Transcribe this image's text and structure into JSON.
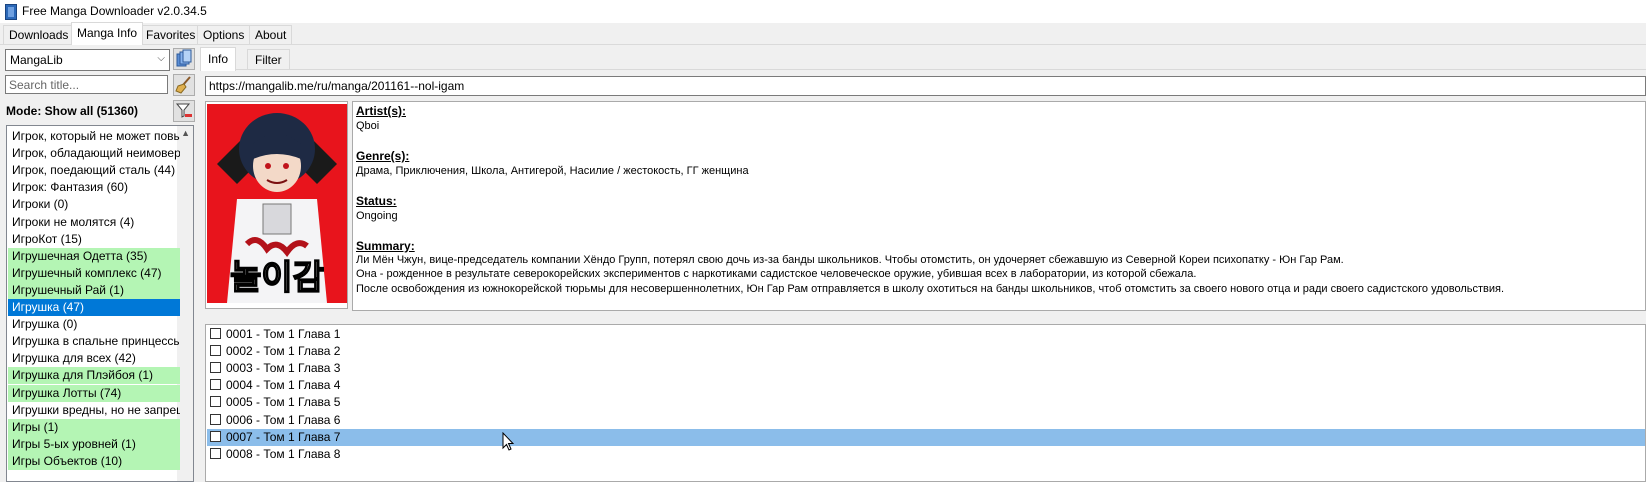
{
  "window": {
    "title": "Free Manga Downloader v2.0.34.5"
  },
  "main_tabs": [
    {
      "label": "Downloads"
    },
    {
      "label": "Manga Info"
    },
    {
      "label": "Favorites"
    },
    {
      "label": "Options"
    },
    {
      "label": "About"
    }
  ],
  "left_panel": {
    "source_selected": "MangaLib",
    "search_placeholder": "Search title...",
    "mode_label": "Mode: Show all (51360)",
    "titles": [
      {
        "label": "Игрок, который не может повы",
        "style": "normal"
      },
      {
        "label": "Игрок, обладающий неимоверн",
        "style": "normal"
      },
      {
        "label": "Игрок, поедающий сталь (44)",
        "style": "normal"
      },
      {
        "label": "Игрок: Фантазия (60)",
        "style": "normal"
      },
      {
        "label": "Игроки (0)",
        "style": "normal"
      },
      {
        "label": "Игроки не молятся (4)",
        "style": "normal"
      },
      {
        "label": "ИгроКот (15)",
        "style": "normal"
      },
      {
        "label": "Игрушечная Одетта (35)",
        "style": "green"
      },
      {
        "label": "Игрушечный комплекс (47)",
        "style": "green"
      },
      {
        "label": "Игрушечный Рай (1)",
        "style": "green"
      },
      {
        "label": "Игрушка (47)",
        "style": "selected"
      },
      {
        "label": "Игрушка (0)",
        "style": "normal"
      },
      {
        "label": "Игрушка в спальне принцессы",
        "style": "normal"
      },
      {
        "label": "Игрушка для всех (42)",
        "style": "normal"
      },
      {
        "label": "Игрушка для Плэйбоя (1)",
        "style": "green"
      },
      {
        "label": "Игрушка Лотты (74)",
        "style": "green"
      },
      {
        "label": "Игрушки вредны, но не запрещ",
        "style": "normal"
      },
      {
        "label": "Игры (1)",
        "style": "green"
      },
      {
        "label": "Игры 5-ых уровней (1)",
        "style": "green"
      },
      {
        "label": "Игры Объектов (10)",
        "style": "green"
      }
    ]
  },
  "sub_tabs": [
    {
      "label": "Info"
    },
    {
      "label": "Filter"
    }
  ],
  "info": {
    "url": "https://mangalib.me/ru/manga/201161--nol-igam",
    "artist_heading": "Artist(s):",
    "artist": "Qboi",
    "genre_heading": "Genre(s):",
    "genres": "Драма, Приключения, Школа, Антигерой, Насилие / жестокость, ГГ женщина",
    "status_heading": "Status:",
    "status": "Ongoing",
    "summary_heading": "Summary:",
    "summary_lines": [
      "Ли Мён Чжун, вице-председатель компании Хёндо Групп, потерял свою дочь из-за банды школьников. Чтобы отомстить, он удочеряет сбежавшую из Северной Кореи психопатку - Юн Гар Рам.",
      "Она - рожденное в результате северокорейских экспериментов с наркотиками садистское человеческое оружие, убившая всех в лаборатории, из которой сбежала.",
      "После освобождения из южнокорейской тюрьмы для несовершеннолетних, Юн Гар Рам отправляется в школу охотиться на банды школьников, чтоб отомстить за своего нового отца и ради своего садистского удовольствия."
    ],
    "cover_title": "놀이감"
  },
  "chapters": [
    {
      "label": "0001 - Том 1 Глава 1"
    },
    {
      "label": "0002 - Том 1 Глава 2"
    },
    {
      "label": "0003 - Том 1 Глава 3"
    },
    {
      "label": "0004 - Том 1 Глава 4"
    },
    {
      "label": "0005 - Том 1 Глава 5"
    },
    {
      "label": "0006 - Том 1 Глава 6"
    },
    {
      "label": "0007 - Том 1 Глава 7",
      "highlighted": true
    },
    {
      "label": "0008 - Том 1 Глава 8"
    }
  ],
  "colors": {
    "selected": "#0078d7",
    "green_row": "#b4f5b4",
    "highlight_row": "#8bbdea"
  }
}
